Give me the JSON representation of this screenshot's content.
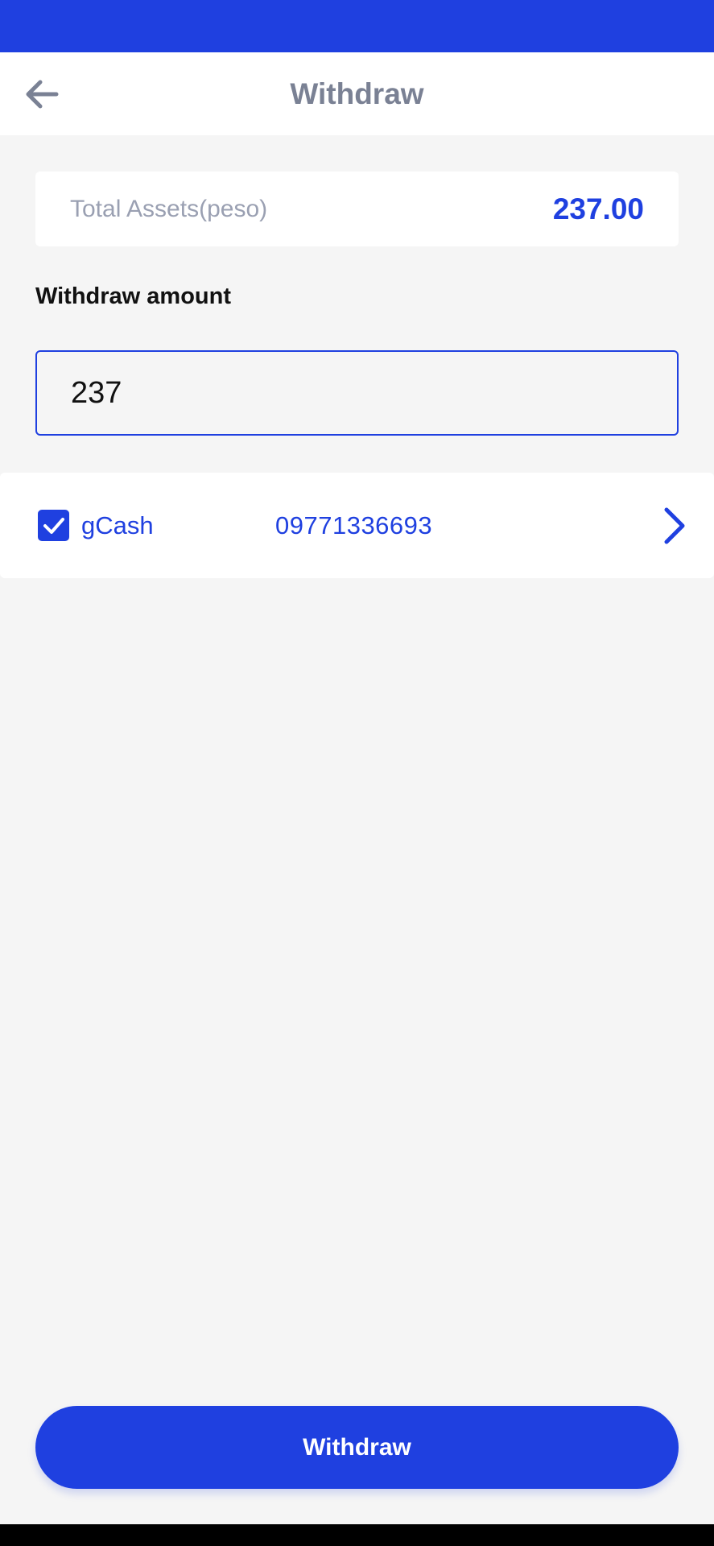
{
  "header": {
    "title": "Withdraw",
    "back_icon": "arrow-left-icon"
  },
  "assets": {
    "label": "Total Assets(peso)",
    "value": "237.00"
  },
  "amount": {
    "label": "Withdraw amount",
    "value": "237"
  },
  "method": {
    "checked": true,
    "name": "gCash",
    "number": "09771336693",
    "chevron_icon": "chevron-right-icon"
  },
  "footer": {
    "submit_label": "Withdraw"
  },
  "colors": {
    "accent": "#1f40e0",
    "background": "#f5f5f5",
    "card": "#ffffff",
    "title_gray": "#7a8194"
  }
}
